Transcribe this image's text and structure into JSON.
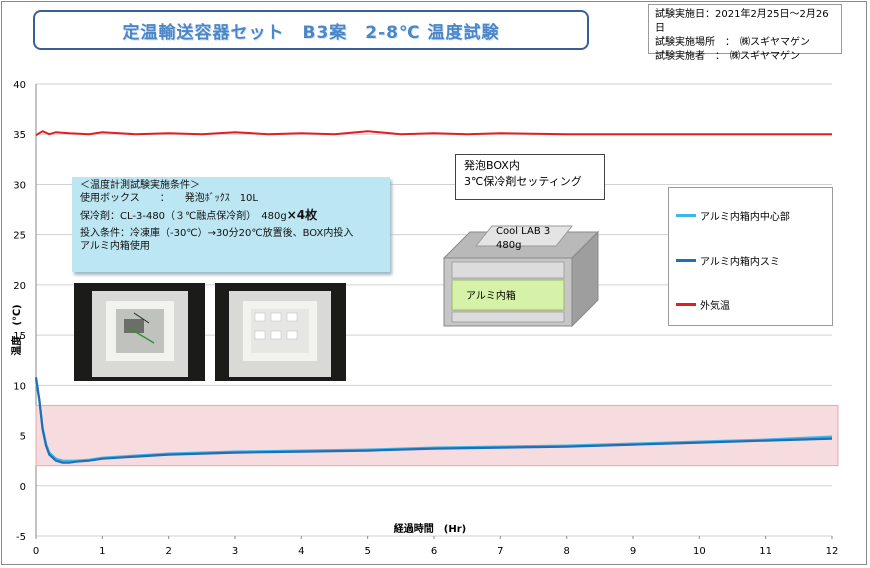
{
  "title": "定温輸送容器セット　B3案　2-8℃ 温度試験",
  "info": {
    "line1": "試験実施日：2021年2月25日～2月26日",
    "line2": "試験実施場所　：　㈱スギヤマゲン",
    "line3": "試験実施者　：　㈱スギヤマゲン"
  },
  "conditions": {
    "heading": "＜温度計測試験実施条件＞",
    "box": "使用ボックス　　：　　発泡ﾎﾞｯｸｽ　10L",
    "coolant": "保冷剤：CL-3-480（３℃融点保冷剤）　480g",
    "coolant_count": "×4枚",
    "input1": "投入条件：冷凍庫（-30℃）→30分20℃放置後、BOX内投入",
    "input2": "アルミ内箱使用"
  },
  "setting": {
    "line1": "発泡BOX内",
    "line2": "3℃保冷剤セッティング"
  },
  "diagram": {
    "coolant_label": "Cool LAB 3",
    "coolant_weight": "480g",
    "inner_box_label": "アルミ内箱"
  },
  "colors": {
    "center": "#3fb6e8",
    "corner": "#1f6fb5",
    "ambient": "#e02020",
    "band": "#f6dcdf",
    "band_border": "#e3a9ae"
  },
  "chart_data": {
    "type": "line",
    "xlabel": "経過時間　(Hr)",
    "ylabel": "温度　(℃)",
    "xlim": [
      0,
      12
    ],
    "ylim": [
      -5,
      40
    ],
    "xticks": [
      0,
      1,
      2,
      3,
      4,
      5,
      6,
      7,
      8,
      9,
      10,
      11,
      12
    ],
    "yticks": [
      -5,
      0,
      5,
      10,
      15,
      20,
      25,
      30,
      35,
      40
    ],
    "grid": true,
    "legend_position": "right",
    "target_band": [
      2,
      8
    ],
    "series": [
      {
        "name": "アルミ内箱内中心部",
        "x": [
          0,
          0.05,
          0.1,
          0.15,
          0.2,
          0.3,
          0.4,
          0.5,
          0.6,
          0.8,
          1,
          1.5,
          2,
          3,
          4,
          5,
          6,
          7,
          8,
          9,
          10,
          11,
          12
        ],
        "y": [
          10.5,
          8.5,
          5.8,
          4.2,
          3.3,
          2.7,
          2.5,
          2.5,
          2.5,
          2.6,
          2.8,
          3.0,
          3.2,
          3.4,
          3.5,
          3.6,
          3.8,
          3.9,
          4.0,
          4.2,
          4.4,
          4.6,
          4.9
        ]
      },
      {
        "name": "アルミ内箱内スミ",
        "x": [
          0,
          0.05,
          0.1,
          0.15,
          0.2,
          0.3,
          0.4,
          0.5,
          0.6,
          0.8,
          1,
          1.5,
          2,
          3,
          4,
          5,
          6,
          7,
          8,
          9,
          10,
          11,
          12
        ],
        "y": [
          10.8,
          8.6,
          5.6,
          4.0,
          3.1,
          2.5,
          2.3,
          2.3,
          2.4,
          2.5,
          2.7,
          2.9,
          3.1,
          3.3,
          3.4,
          3.5,
          3.7,
          3.8,
          3.9,
          4.1,
          4.3,
          4.5,
          4.7
        ]
      },
      {
        "name": "外気温",
        "x": [
          0,
          0.1,
          0.2,
          0.3,
          0.5,
          0.8,
          1,
          1.5,
          2,
          2.5,
          3,
          3.5,
          4,
          4.5,
          5,
          5.5,
          6,
          6.5,
          7,
          8,
          9,
          10,
          11,
          12
        ],
        "y": [
          34.9,
          35.3,
          35.0,
          35.2,
          35.1,
          35.0,
          35.2,
          35.0,
          35.1,
          35.0,
          35.2,
          35.0,
          35.1,
          35.0,
          35.3,
          35.0,
          35.1,
          35.0,
          35.1,
          35.0,
          35.0,
          35.0,
          35.0,
          35.0
        ]
      }
    ]
  }
}
